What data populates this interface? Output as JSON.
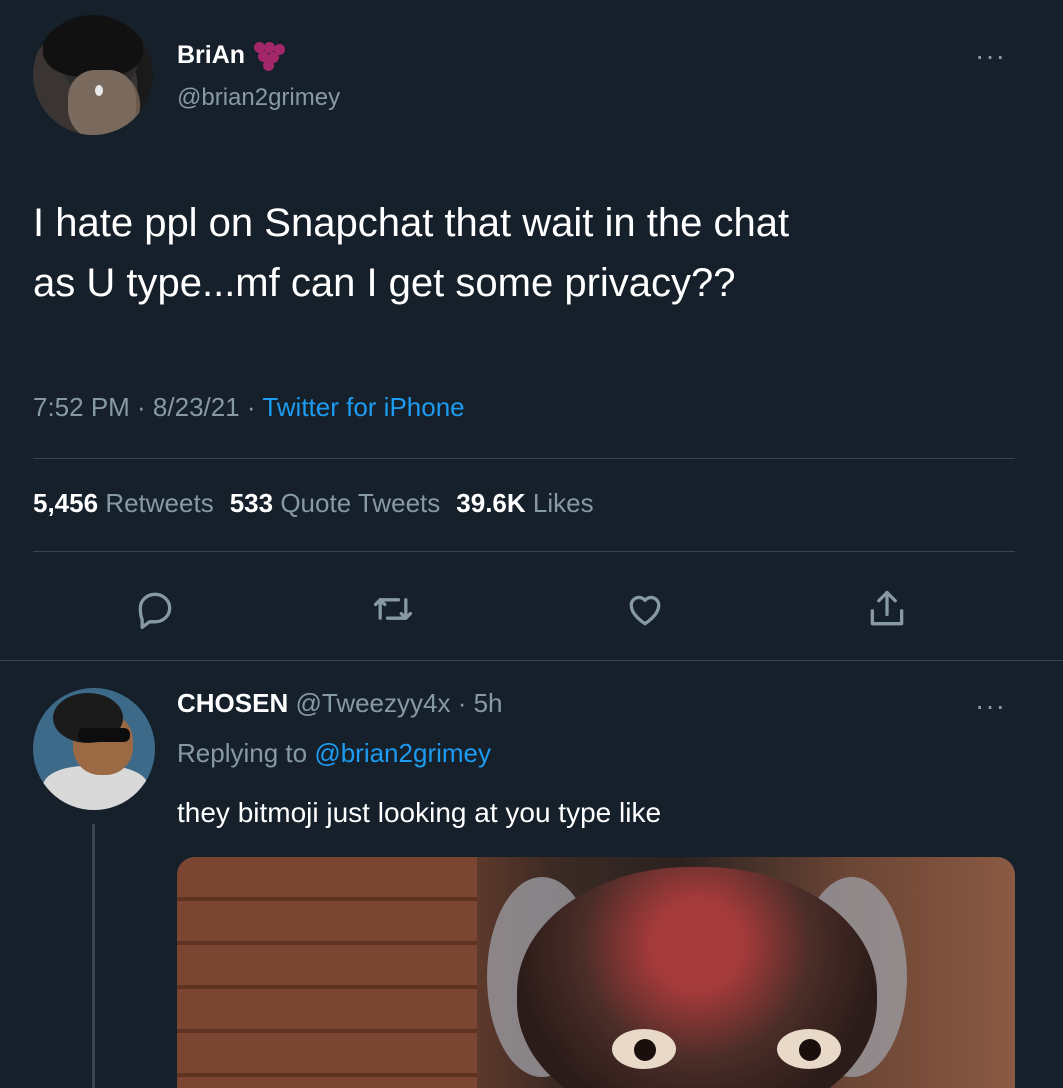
{
  "tweet": {
    "display_name": "BriAn",
    "handle": "@brian2grimey",
    "more_label": "···",
    "text_line1": "I hate ppl on Snapchat that wait in the chat",
    "text_line2": "as U type...mf can I get some privacy??",
    "time": "7:52 PM · 8/23/21 · ",
    "source": "Twitter for iPhone",
    "stats": {
      "retweets_count": "5,456",
      "retweets_label": "Retweets",
      "quotes_count": "533",
      "quotes_label": "Quote Tweets",
      "likes_count": "39.6K",
      "likes_label": "Likes"
    },
    "actions": [
      "reply-icon",
      "retweet-icon",
      "like-icon",
      "share-icon"
    ]
  },
  "reply": {
    "display_name": "CHOSEN",
    "handle_time": "@Tweezyy4x · 5h",
    "replying_prefix": "Replying to ",
    "replying_handle": "@brian2grimey",
    "text": "they bitmoji just looking at you type like",
    "more_label": "···"
  },
  "colors": {
    "background": "#15202b",
    "secondary_text": "#8899a6",
    "link": "#1d9bf0",
    "divider": "#38444d"
  }
}
